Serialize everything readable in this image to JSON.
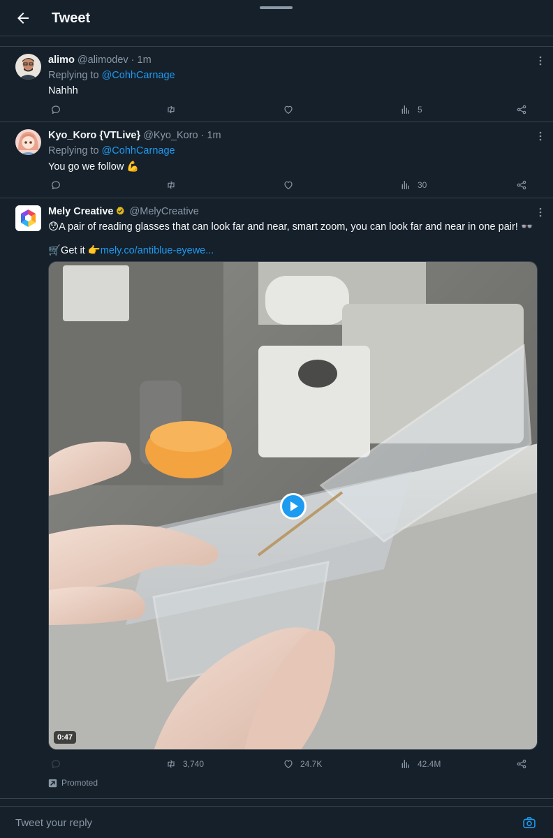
{
  "header": {
    "title": "Tweet"
  },
  "tweets": [
    {
      "name": "alimo",
      "handle": "@alimodev · 1m",
      "replying_prefix": "Replying to",
      "replying_to": "@CohhCarnage",
      "text": "Nahhh",
      "views": "5"
    },
    {
      "name": "Kyo_Koro {VTLive}",
      "handle": "@Kyo_Koro · 1m",
      "replying_prefix": "Replying to",
      "replying_to": "@CohhCarnage",
      "text": "You go we follow 💪",
      "views": "30"
    },
    {
      "name": "Mely Creative",
      "handle": "@MelyCreative",
      "text": "😯A pair of reading glasses that can look far and near, smart zoom, you can look far and near in one pair! 👓",
      "cta_prefix": "🛒Get it 👉",
      "cta_link": "mely.co/antiblue-eyewe...",
      "video_duration": "0:47",
      "retweets": "3,740",
      "likes": "24.7K",
      "views": "42.4M",
      "promoted_label": "Promoted"
    }
  ],
  "reply_bar": {
    "placeholder": "Tweet your reply"
  },
  "colors": {
    "background": "#15202b",
    "accent": "#1d9bf0",
    "muted": "#8b98a5",
    "border": "#38444d"
  }
}
